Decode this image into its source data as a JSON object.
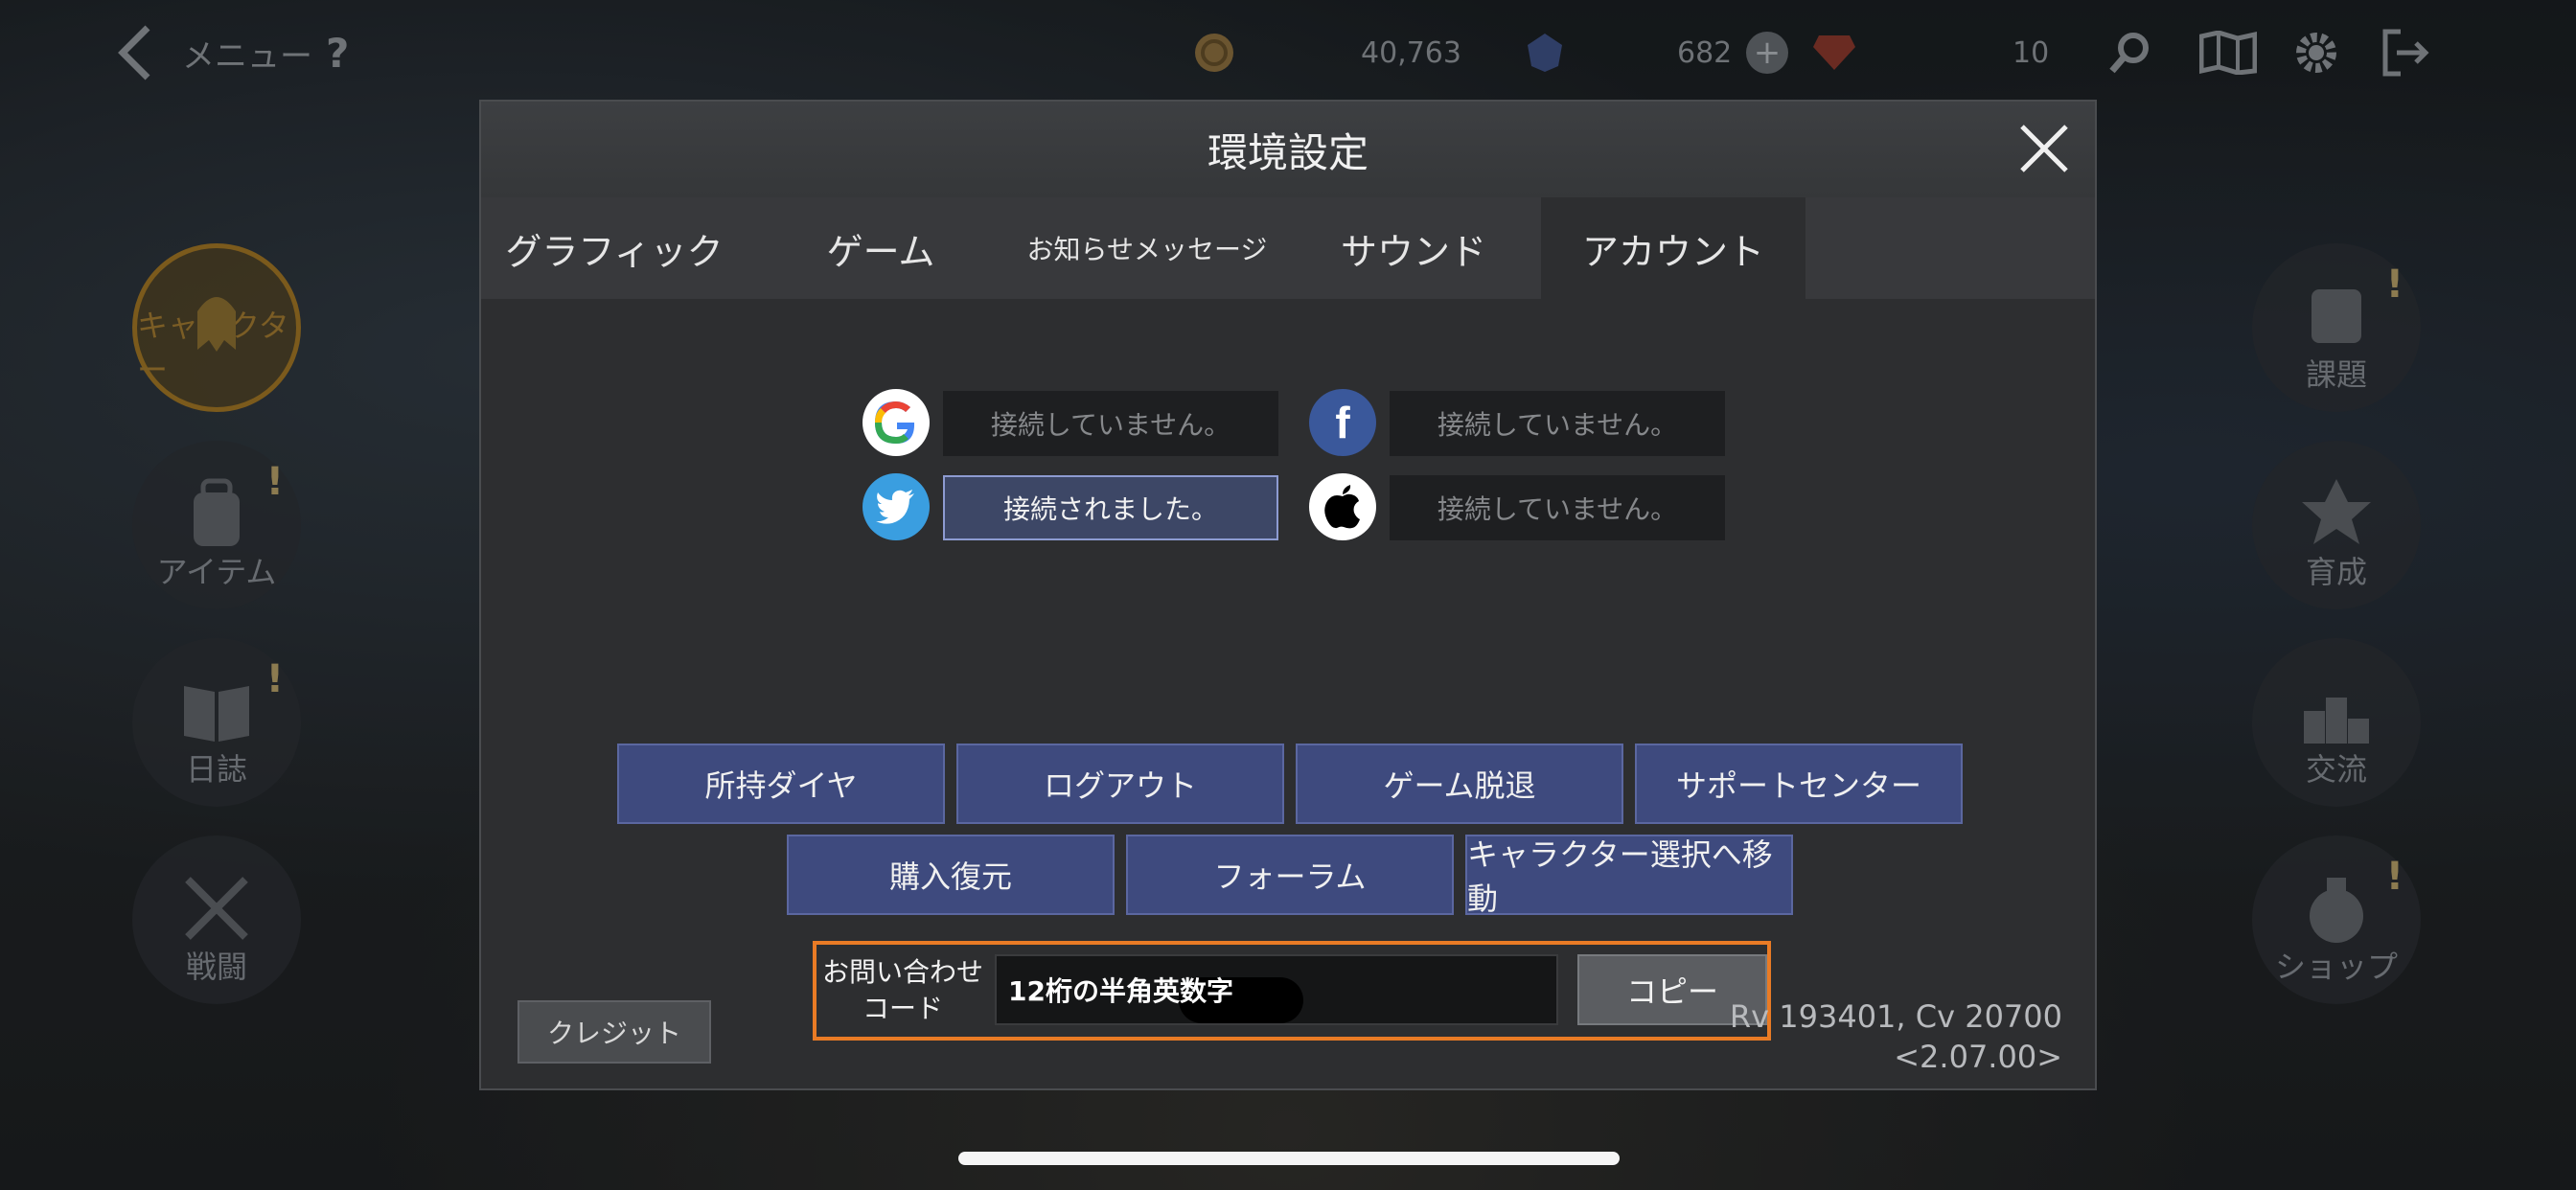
{
  "hud": {
    "menu_label": "メニュー",
    "help_label": "?",
    "gold": "40,763",
    "gems": "682",
    "plus": "+",
    "rubies": "10"
  },
  "side_menu": {
    "left": [
      {
        "label": "キャラクター"
      },
      {
        "label": "アイテム"
      },
      {
        "label": "日誌"
      },
      {
        "label": "戦闘"
      }
    ],
    "right": [
      {
        "label": "課題"
      },
      {
        "label": "育成"
      },
      {
        "label": "交流"
      },
      {
        "label": "ショップ"
      }
    ],
    "alert_mark": "!"
  },
  "dialog": {
    "title": "環境設定",
    "tabs": [
      {
        "label": "グラフィック"
      },
      {
        "label": "ゲーム"
      },
      {
        "label": "お知らせメッセージ"
      },
      {
        "label": "サウンド"
      },
      {
        "label": "アカウント"
      }
    ],
    "accounts": {
      "google": "接続していません。",
      "facebook": "接続していません。",
      "twitter": "接続されました。",
      "apple": "接続していません。"
    },
    "buttons": {
      "row1": [
        "所持ダイヤ",
        "ログアウト",
        "ゲーム脱退",
        "サポートセンター"
      ],
      "row2": [
        "購入復元",
        "フォーラム",
        "キャラクター選択へ移動"
      ]
    },
    "credit_label": "クレジット",
    "inquiry": {
      "label_line1": "お問い合わせ",
      "label_line2": "コード",
      "value": "12桁の半角英数字",
      "copy_label": "コピー"
    },
    "version_line1": "Rv 193401, Cv 20700",
    "version_line2": "<2.07.00>"
  }
}
